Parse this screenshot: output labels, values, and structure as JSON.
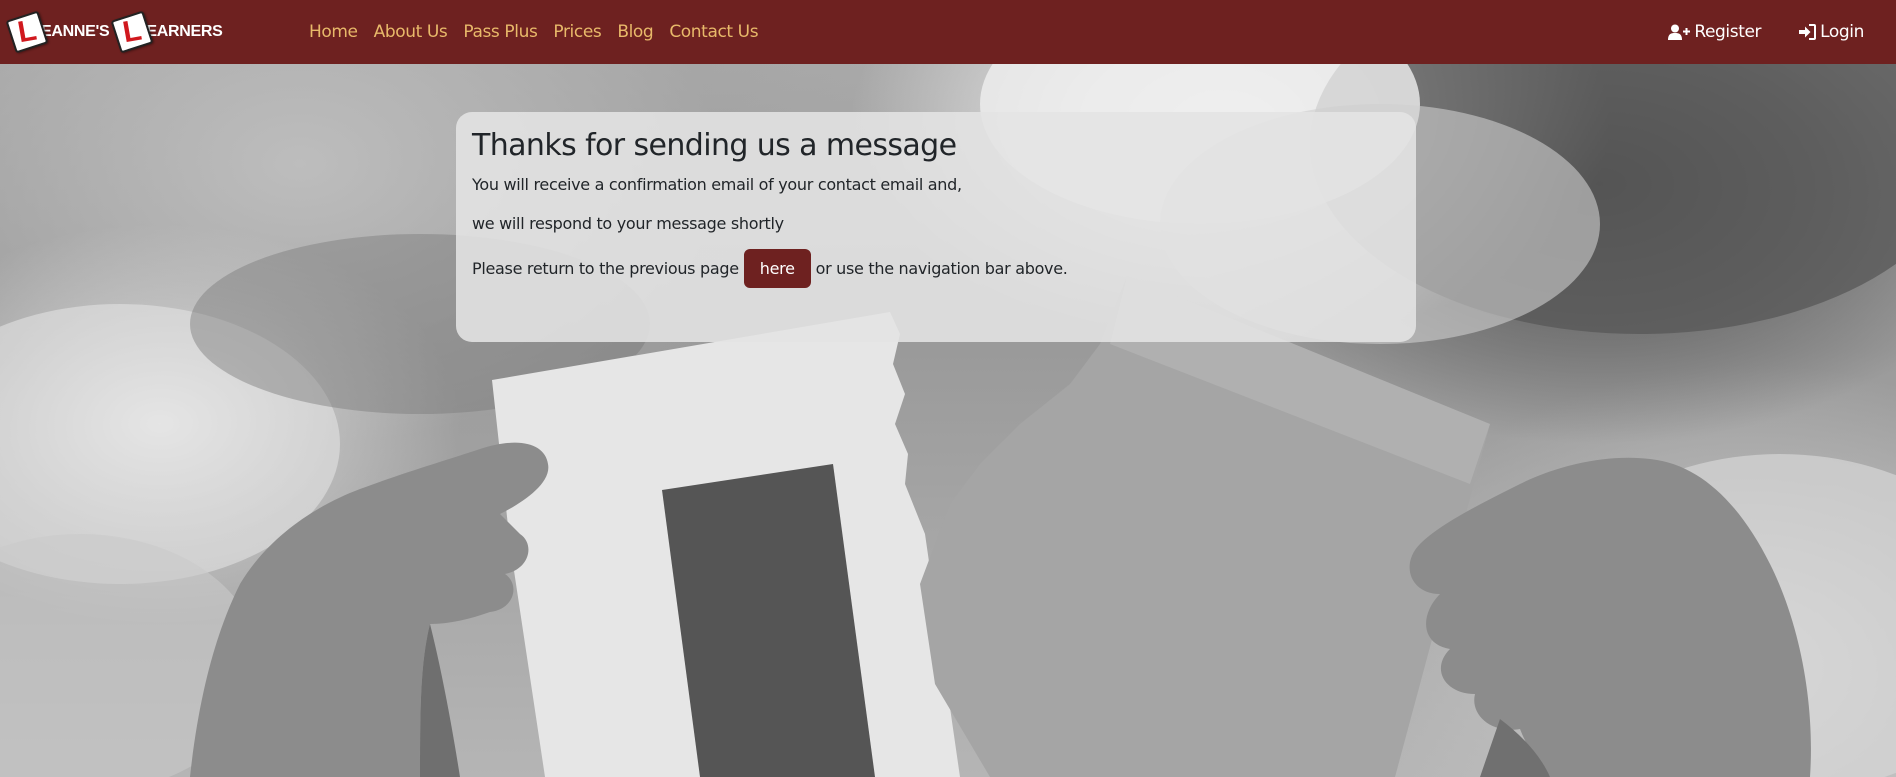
{
  "brand": {
    "plate_letter": "L",
    "word1": "EANNE'S",
    "word2": "EARNERS",
    "colors": {
      "navbar": "#6e2120",
      "link": "#e8b96a",
      "plate_letter": "#d0181e"
    }
  },
  "nav": {
    "links": [
      "Home",
      "About Us",
      "Pass Plus",
      "Prices",
      "Blog",
      "Contact Us"
    ],
    "register_label": "Register",
    "register_icon": "user-plus-icon",
    "login_label": "Login",
    "login_icon": "sign-in-icon"
  },
  "message": {
    "title": "Thanks for sending us a message",
    "line1": "You will receive a confirmation email of your contact email and,",
    "line2": "we will respond to your message shortly",
    "return_prefix": "Please return to the previous page",
    "here_label": "here",
    "return_suffix": "or use the navigation bar above."
  },
  "background": {
    "image_subject": "hands tearing an L-plate learner sign"
  }
}
